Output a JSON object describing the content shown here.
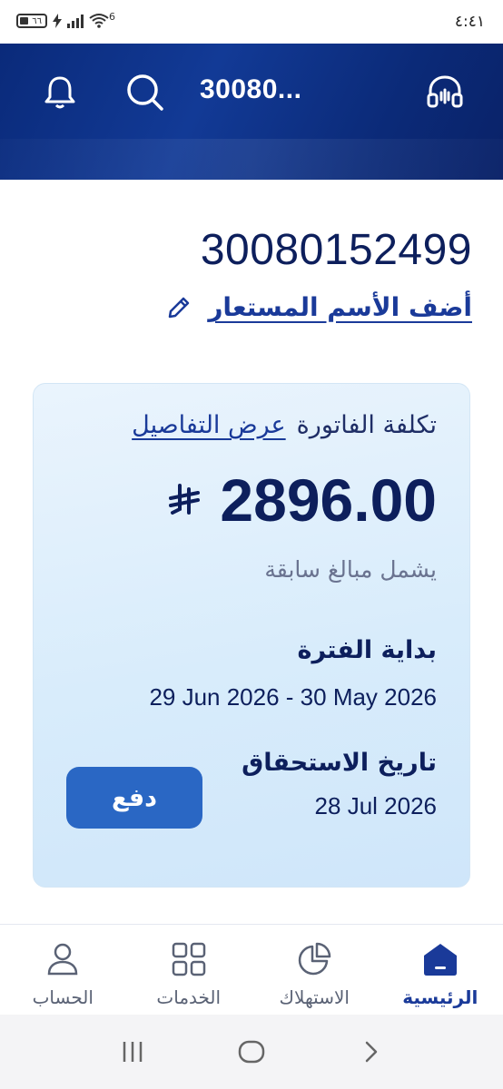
{
  "status_bar": {
    "time": "٤:٤١",
    "battery_level": "٦٦",
    "network": "6"
  },
  "header": {
    "account_title": "30080...",
    "icons": [
      "bell-icon",
      "search-icon",
      "headset-icon"
    ]
  },
  "account": {
    "number": "30080152499",
    "nickname_link": "أضف الأسم المستعار"
  },
  "bill": {
    "label": "تكلفة الفاتورة",
    "details_link": "عرض التفاصيل",
    "amount": "2896.00",
    "currency_icon": "saudi-riyal-icon",
    "note": "يشمل مبالغ سابقة",
    "period_label": "بداية الفترة",
    "period_value": "29 Jun 2026 - 30 May 2026",
    "due_label": "تاريخ الاستحقاق",
    "due_value": "28 Jul 2026",
    "pay_button": "دفع"
  },
  "bottom_nav": [
    {
      "label": "الحساب",
      "icon": "person-icon",
      "active": false
    },
    {
      "label": "الخدمات",
      "icon": "grid-icon",
      "active": false
    },
    {
      "label": "الاستهلاك",
      "icon": "pie-chart-icon",
      "active": false
    },
    {
      "label": "الرئيسية",
      "icon": "home-icon",
      "active": true
    }
  ],
  "colors": {
    "brand_dark": "#0a2a7a",
    "accent": "#2a67c4",
    "card_bg": "#d8ecfb",
    "text_primary": "#0d1f5c"
  }
}
